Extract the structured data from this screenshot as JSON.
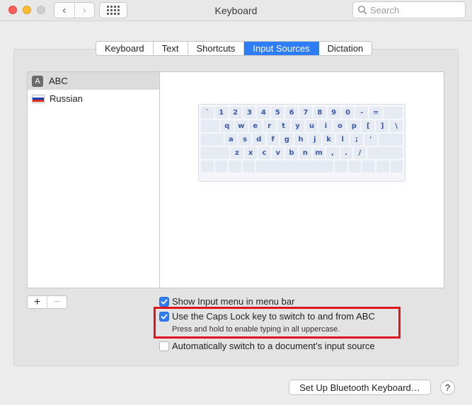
{
  "window": {
    "title": "Keyboard"
  },
  "toolbar": {
    "back_glyph": "‹",
    "forward_glyph": "›",
    "search_placeholder": "Search"
  },
  "tabs": [
    {
      "label": "Keyboard",
      "active": false
    },
    {
      "label": "Text",
      "active": false
    },
    {
      "label": "Shortcuts",
      "active": false
    },
    {
      "label": "Input Sources",
      "active": true
    },
    {
      "label": "Dictation",
      "active": false
    }
  ],
  "sources": [
    {
      "label": "ABC",
      "icon": "abc-letter-icon",
      "selected": true,
      "icon_text": "A"
    },
    {
      "label": "Russian",
      "icon": "russian-flag-icon",
      "selected": false
    }
  ],
  "keyboard_rows": [
    [
      "`",
      "1",
      "2",
      "3",
      "4",
      "5",
      "6",
      "7",
      "8",
      "9",
      "0",
      "-",
      "="
    ],
    [
      "q",
      "w",
      "e",
      "r",
      "t",
      "y",
      "u",
      "i",
      "o",
      "p",
      "[",
      "]",
      "\\"
    ],
    [
      "a",
      "s",
      "d",
      "f",
      "g",
      "h",
      "j",
      "k",
      "l",
      ";",
      "'"
    ],
    [
      "z",
      "x",
      "c",
      "v",
      "b",
      "n",
      "m",
      ",",
      ".",
      "/"
    ]
  ],
  "list_controls": {
    "add": "+",
    "remove": "−"
  },
  "options": {
    "show_input_menu": {
      "label": "Show Input menu in menu bar",
      "checked": true
    },
    "caps_lock_switch": {
      "label": "Use the Caps Lock key to switch to and from ABC",
      "checked": true,
      "help": "Press and hold to enable typing in all uppercase."
    },
    "auto_switch": {
      "label": "Automatically switch to a document’s input source",
      "checked": false
    }
  },
  "bottom": {
    "bluetooth_button": "Set Up Bluetooth Keyboard…",
    "help_button": "?"
  },
  "colors": {
    "accent": "#2e7cf6",
    "highlight_box": "#e0161c",
    "key_text": "#3b5aa8"
  }
}
